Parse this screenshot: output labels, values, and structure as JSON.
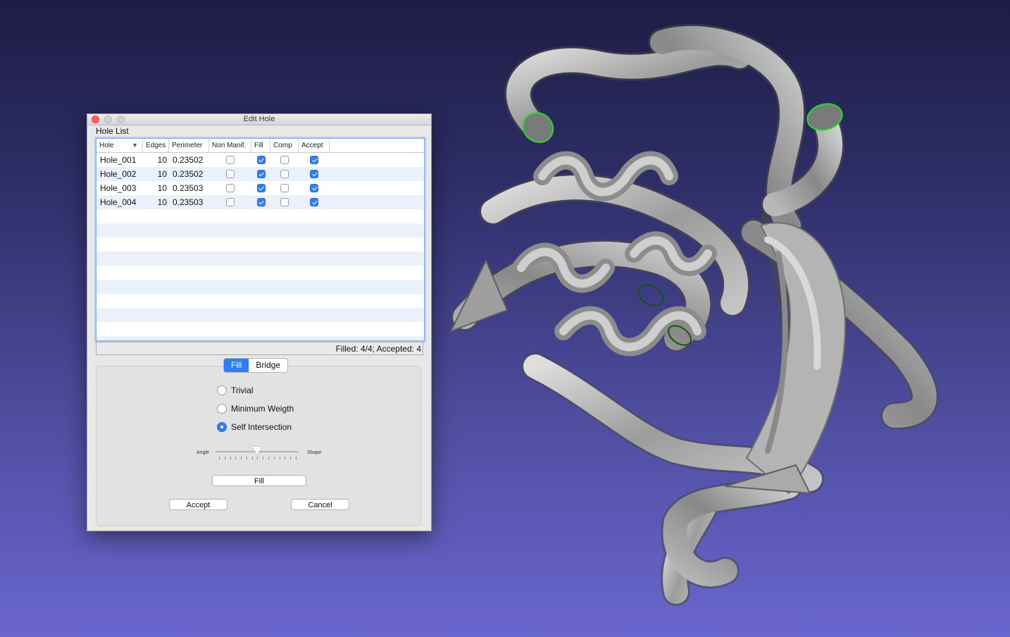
{
  "dialog": {
    "title": "Edit Hole",
    "group_label": "Hole List",
    "columns": [
      "Hole",
      "Edges",
      "Perimeter",
      "Non Manif.",
      "Fill",
      "Comp",
      "Accept"
    ],
    "rows": [
      {
        "name": "Hole_001",
        "edges": "10",
        "perimeter": "0.23502",
        "non_manif": false,
        "fill": true,
        "comp": false,
        "accept": true
      },
      {
        "name": "Hole_002",
        "edges": "10",
        "perimeter": "0.23502",
        "non_manif": false,
        "fill": true,
        "comp": false,
        "accept": true
      },
      {
        "name": "Hole_003",
        "edges": "10",
        "perimeter": "0.23503",
        "non_manif": false,
        "fill": true,
        "comp": false,
        "accept": true
      },
      {
        "name": "Hole_004",
        "edges": "10",
        "perimeter": "0.23503",
        "non_manif": false,
        "fill": true,
        "comp": false,
        "accept": true
      }
    ],
    "status": "Filled: 4/4; Accepted: 4",
    "tabs": {
      "fill": "Fill",
      "bridge": "Bridge",
      "active": "fill"
    },
    "methods": [
      {
        "label": "Trivial",
        "selected": false
      },
      {
        "label": "Minimum Weigth",
        "selected": false
      },
      {
        "label": "Self Intersection",
        "selected": true
      }
    ],
    "slider": {
      "left_label": "Angle",
      "right_label": "Shape",
      "value": 0.5
    },
    "fill_button": "Fill",
    "accept_button": "Accept",
    "cancel_button": "Cancel"
  },
  "colors": {
    "accent": "#2f7ef6",
    "hole_highlight": "#20d420",
    "mesh": "#a9a9a9"
  }
}
